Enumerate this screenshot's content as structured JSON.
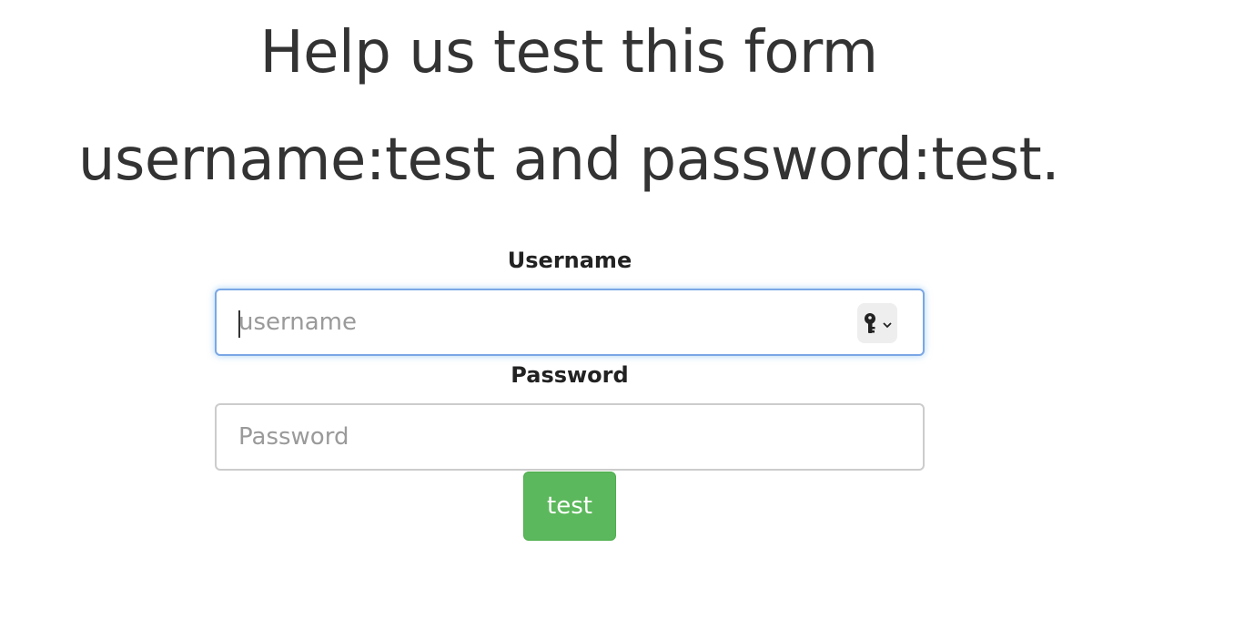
{
  "heading": {
    "line1": "Help us test this form",
    "line2": "username:test and password:test."
  },
  "form": {
    "username": {
      "label": "Username",
      "value": "",
      "placeholder": "username",
      "focused": true,
      "autofill_icon": "key-icon"
    },
    "password": {
      "label": "Password",
      "value": "",
      "placeholder": "Password"
    },
    "submit_label": "test"
  },
  "colors": {
    "text": "#333333",
    "submit_bg": "#5cb85c",
    "focus_border": "#7aa7e6",
    "input_border": "#cccccc",
    "placeholder": "#9a9a9a"
  }
}
